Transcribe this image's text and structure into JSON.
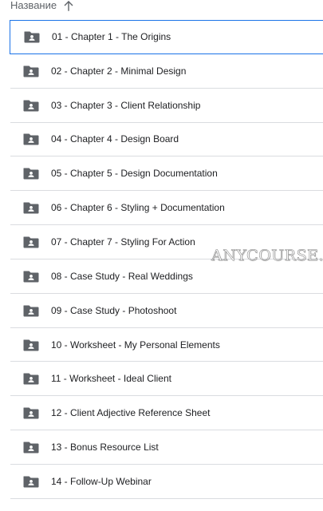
{
  "header": {
    "column_title": "Название",
    "sort_icon": "arrow-up-icon"
  },
  "items": [
    {
      "label": "01 - Chapter 1 - The Origins",
      "icon": "shared-folder-icon",
      "selected": true
    },
    {
      "label": "02 - Chapter 2 - Minimal Design",
      "icon": "shared-folder-icon"
    },
    {
      "label": "03 - Chapter 3 - Client Relationship",
      "icon": "shared-folder-icon"
    },
    {
      "label": "04 - Chapter 4 - Design Board",
      "icon": "shared-folder-icon"
    },
    {
      "label": "05 - Chapter 5 - Design Documentation",
      "icon": "shared-folder-icon"
    },
    {
      "label": "06 - Chapter 6 - Styling + Documentation",
      "icon": "shared-folder-icon"
    },
    {
      "label": "07 - Chapter 7 - Styling For Action",
      "icon": "shared-folder-icon"
    },
    {
      "label": "08 - Case Study - Real Weddings",
      "icon": "shared-folder-icon"
    },
    {
      "label": "09 - Case Study - Photoshoot",
      "icon": "shared-folder-icon"
    },
    {
      "label": "10 - Worksheet - My Personal Elements",
      "icon": "shared-folder-icon"
    },
    {
      "label": "11 - Worksheet - Ideal Client",
      "icon": "shared-folder-icon"
    },
    {
      "label": "12 - Client Adjective Reference Sheet",
      "icon": "shared-folder-icon"
    },
    {
      "label": "13 - Bonus Resource List",
      "icon": "shared-folder-icon"
    },
    {
      "label": "14 - Follow-Up Webinar",
      "icon": "shared-folder-icon"
    }
  ],
  "watermark": "ANYCOURSE.RU",
  "colors": {
    "selection_border": "#1a73e8",
    "folder_icon": "#5f6368",
    "divider": "#dadce0",
    "text": "#202124",
    "header_text": "#5f6368"
  }
}
